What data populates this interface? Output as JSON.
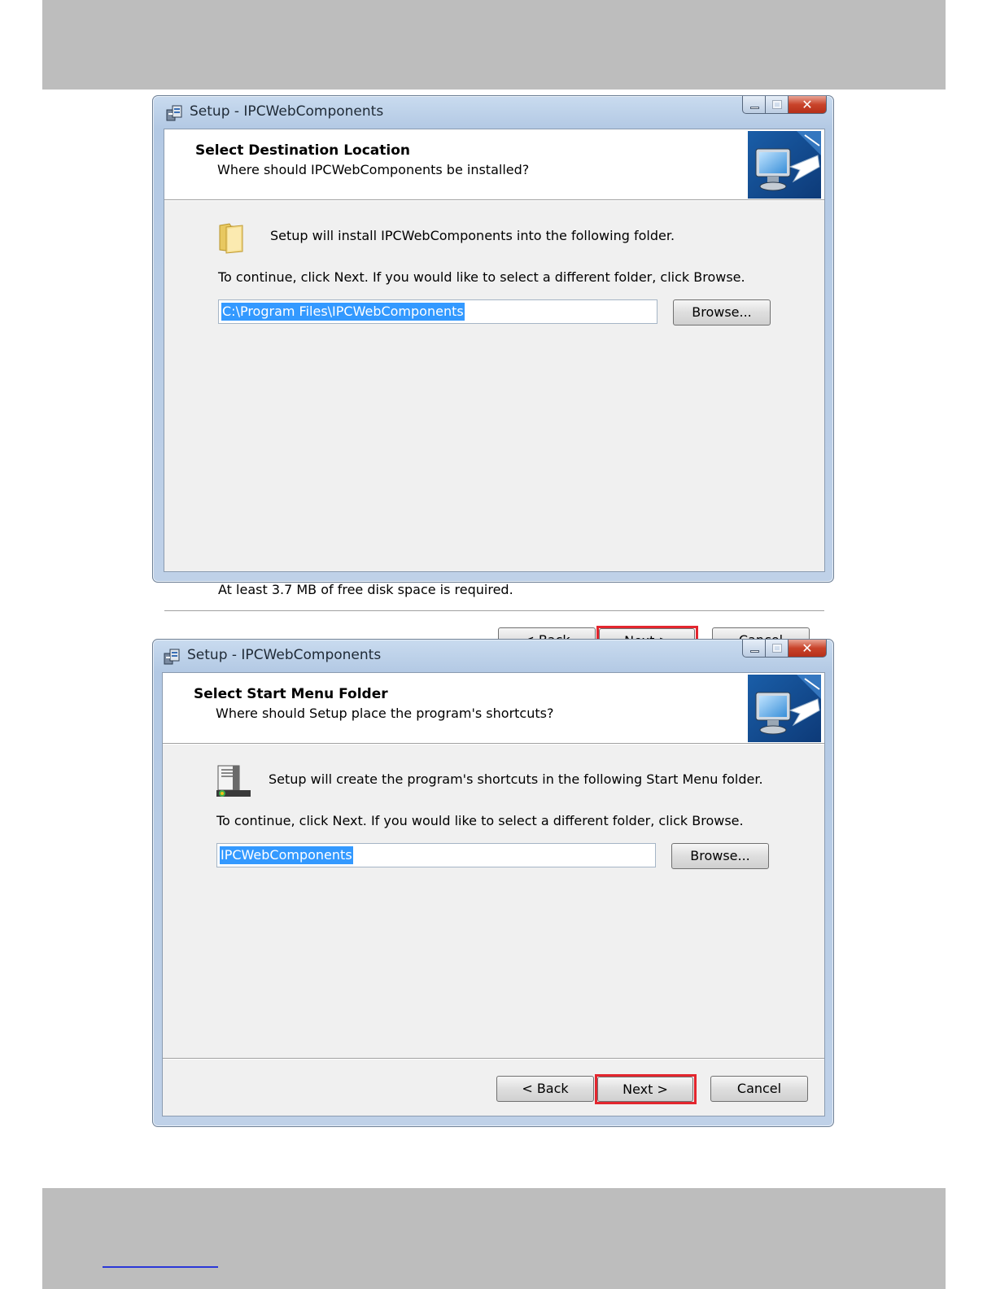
{
  "dialogs": [
    {
      "window_title": "Setup - IPCWebComponents",
      "header_title": "Select Destination Location",
      "header_subtitle": "Where should IPCWebComponents be installed?",
      "lead_text": "Setup will install IPCWebComponents into the following folder.",
      "instruction": "To continue, click Next. If you would like to select a different folder, click Browse.",
      "input_value": "C:\\Program Files\\IPCWebComponents",
      "browse_label": "Browse...",
      "disk_space_text": "At least 3.7 MB of free disk space is required.",
      "back_label": "< Back",
      "next_label": "Next >",
      "cancel_label": "Cancel",
      "content_icon": "folder-icon"
    },
    {
      "window_title": "Setup - IPCWebComponents",
      "header_title": "Select Start Menu Folder",
      "header_subtitle": "Where should Setup place the program's shortcuts?",
      "lead_text": "Setup will create the program's shortcuts in the following Start Menu folder.",
      "instruction": "To continue, click Next. If you would like to select a different folder, click Browse.",
      "input_value": "IPCWebComponents",
      "browse_label": "Browse...",
      "back_label": "< Back",
      "next_label": "Next >",
      "cancel_label": "Cancel",
      "content_icon": "start-menu-folder-icon"
    }
  ],
  "colors": {
    "selection": "#3399ff",
    "highlight_box": "#e3262e",
    "page_band": "#bdbdbd"
  }
}
